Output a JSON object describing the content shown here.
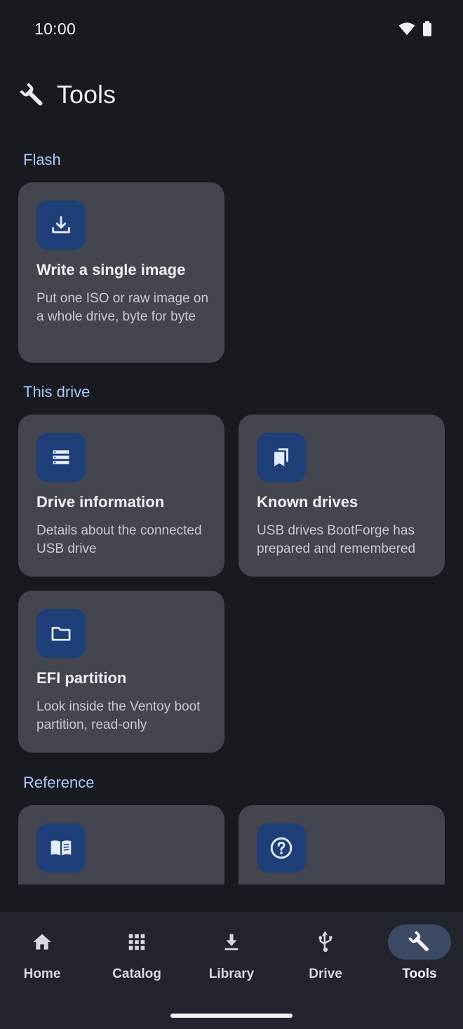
{
  "status": {
    "time": "10:00"
  },
  "app_bar": {
    "title": "Tools",
    "icon": "wrench-icon"
  },
  "sections": {
    "flash": "Flash",
    "this_drive": "This drive",
    "reference": "Reference"
  },
  "cards": {
    "write_image": {
      "title": "Write a single image",
      "desc": "Put one ISO or raw image on a whole drive, byte for byte",
      "icon": "download-icon"
    },
    "drive_info": {
      "title": "Drive information",
      "desc": "Details about the connected USB drive",
      "icon": "storage-list-icon"
    },
    "known_drives": {
      "title": "Known drives",
      "desc": "USB drives BootForge has prepared and remembered",
      "icon": "bookmarks-icon"
    },
    "efi_partition": {
      "title": "EFI partition",
      "desc": "Look inside the Ventoy boot partition, read-only",
      "icon": "folder-icon"
    },
    "reference_guide": {
      "icon": "book-open-icon"
    },
    "help": {
      "icon": "help-circle-icon"
    }
  },
  "nav": {
    "items": [
      {
        "label": "Home",
        "icon": "home-icon"
      },
      {
        "label": "Catalog",
        "icon": "grid-icon"
      },
      {
        "label": "Library",
        "icon": "download-icon"
      },
      {
        "label": "Drive",
        "icon": "usb-icon"
      },
      {
        "label": "Tools",
        "icon": "wrench-icon",
        "active": true
      }
    ]
  },
  "colors": {
    "background": "#181a20",
    "card": "#43464f",
    "icon_box": "#1e3f77",
    "section_header": "#a9c7ff",
    "nav_background": "#22252d",
    "nav_active_pill": "#3c4b63"
  }
}
